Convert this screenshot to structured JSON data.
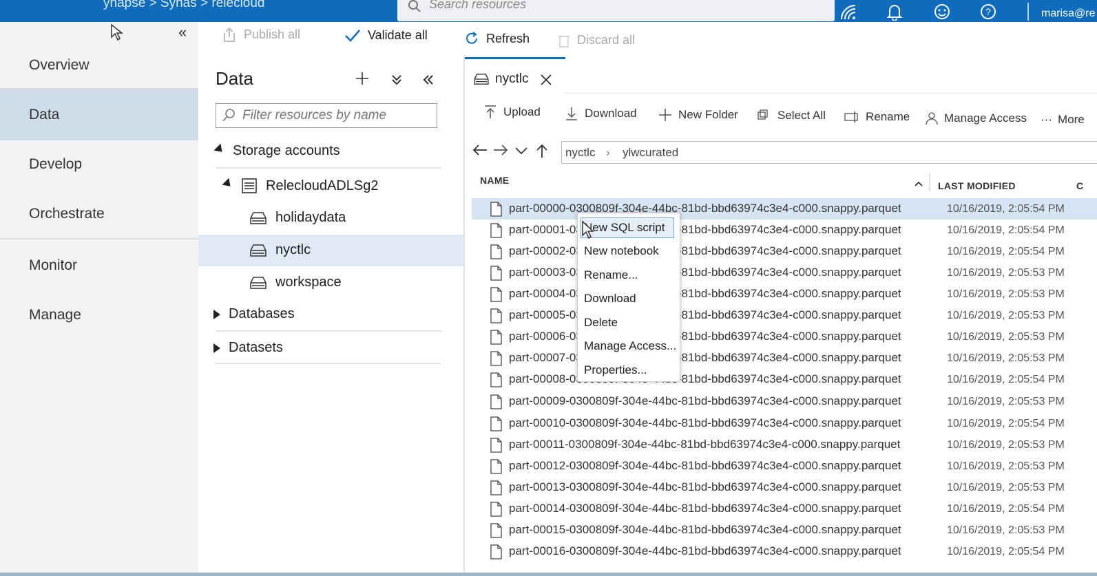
{
  "topbar": {
    "crumbs": "ynapse > Synas > relecloud",
    "search_placeholder": "Search resources",
    "icons": [
      "wifi-signal-icon",
      "bell-icon",
      "smiley-icon",
      "help-icon"
    ],
    "user": "marisa@re"
  },
  "leftnav": {
    "items": [
      {
        "label": "Overview"
      },
      {
        "label": "Data",
        "selected": true
      },
      {
        "label": "Develop"
      },
      {
        "label": "Orchestrate"
      },
      {
        "label": "Monitor"
      },
      {
        "label": "Manage"
      }
    ],
    "collapse_glyph": "«"
  },
  "toolbar": {
    "publish_all": "Publish all",
    "validate_all": "Validate all",
    "refresh": "Refresh",
    "discard_all": "Discard all"
  },
  "datapanel": {
    "title": "Data",
    "filter_placeholder": "Filter resources by name",
    "storage_accounts": "Storage accounts",
    "account": "RelecloudADLSg2",
    "containers": [
      "holidaydata",
      "nyctlc",
      "workspace"
    ],
    "databases": "Databases",
    "datasets": "Datasets"
  },
  "tab": {
    "label": "nyctlc"
  },
  "filetoolbar": {
    "upload": "Upload",
    "download": "Download",
    "new_folder": "New Folder",
    "select_all": "Select All",
    "rename": "Rename",
    "manage_access": "Manage Access",
    "more": "More"
  },
  "path": {
    "root": "nyctlc",
    "sub": "ylwcurated"
  },
  "columns": {
    "name": "NAME",
    "modified": "LAST MODIFIED",
    "extra": "C"
  },
  "files": [
    {
      "name": "part-00000-0300809f-304e-44bc-81bd-bbd63974c3e4-c000.snappy.parquet",
      "modified": "10/16/2019, 2:05:54 PM"
    },
    {
      "name": "part-00001-0300809f-304e-44bc-81bd-bbd63974c3e4-c000.snappy.parquet",
      "modified": "10/16/2019, 2:05:54 PM"
    },
    {
      "name": "part-00002-0300809f-304e-44bc-81bd-bbd63974c3e4-c000.snappy.parquet",
      "modified": "10/16/2019, 2:05:54 PM"
    },
    {
      "name": "part-00003-0300809f-304e-44bc-81bd-bbd63974c3e4-c000.snappy.parquet",
      "modified": "10/16/2019, 2:05:53 PM"
    },
    {
      "name": "part-00004-0300809f-304e-44bc-81bd-bbd63974c3e4-c000.snappy.parquet",
      "modified": "10/16/2019, 2:05:53 PM"
    },
    {
      "name": "part-00005-0300809f-304e-44bc-81bd-bbd63974c3e4-c000.snappy.parquet",
      "modified": "10/16/2019, 2:05:53 PM"
    },
    {
      "name": "part-00006-0300809f-304e-44bc-81bd-bbd63974c3e4-c000.snappy.parquet",
      "modified": "10/16/2019, 2:05:53 PM"
    },
    {
      "name": "part-00007-0300809f-304e-44bc-81bd-bbd63974c3e4-c000.snappy.parquet",
      "modified": "10/16/2019, 2:05:53 PM"
    },
    {
      "name": "part-00008-0300809f-304e-44bc-81bd-bbd63974c3e4-c000.snappy.parquet",
      "modified": "10/16/2019, 2:05:54 PM"
    },
    {
      "name": "part-00009-0300809f-304e-44bc-81bd-bbd63974c3e4-c000.snappy.parquet",
      "modified": "10/16/2019, 2:05:53 PM"
    },
    {
      "name": "part-00010-0300809f-304e-44bc-81bd-bbd63974c3e4-c000.snappy.parquet",
      "modified": "10/16/2019, 2:05:54 PM"
    },
    {
      "name": "part-00011-0300809f-304e-44bc-81bd-bbd63974c3e4-c000.snappy.parquet",
      "modified": "10/16/2019, 2:05:53 PM"
    },
    {
      "name": "part-00012-0300809f-304e-44bc-81bd-bbd63974c3e4-c000.snappy.parquet",
      "modified": "10/16/2019, 2:05:53 PM"
    },
    {
      "name": "part-00013-0300809f-304e-44bc-81bd-bbd63974c3e4-c000.snappy.parquet",
      "modified": "10/16/2019, 2:05:53 PM"
    },
    {
      "name": "part-00014-0300809f-304e-44bc-81bd-bbd63974c3e4-c000.snappy.parquet",
      "modified": "10/16/2019, 2:05:54 PM"
    },
    {
      "name": "part-00015-0300809f-304e-44bc-81bd-bbd63974c3e4-c000.snappy.parquet",
      "modified": "10/16/2019, 2:05:53 PM"
    },
    {
      "name": "part-00016-0300809f-304e-44bc-81bd-bbd63974c3e4-c000.snappy.parquet",
      "modified": "10/16/2019, 2:05:54 PM"
    }
  ],
  "context_menu": [
    "New SQL script",
    "New notebook",
    "Rename...",
    "Download",
    "Delete",
    "Manage Access...",
    "Properties..."
  ]
}
